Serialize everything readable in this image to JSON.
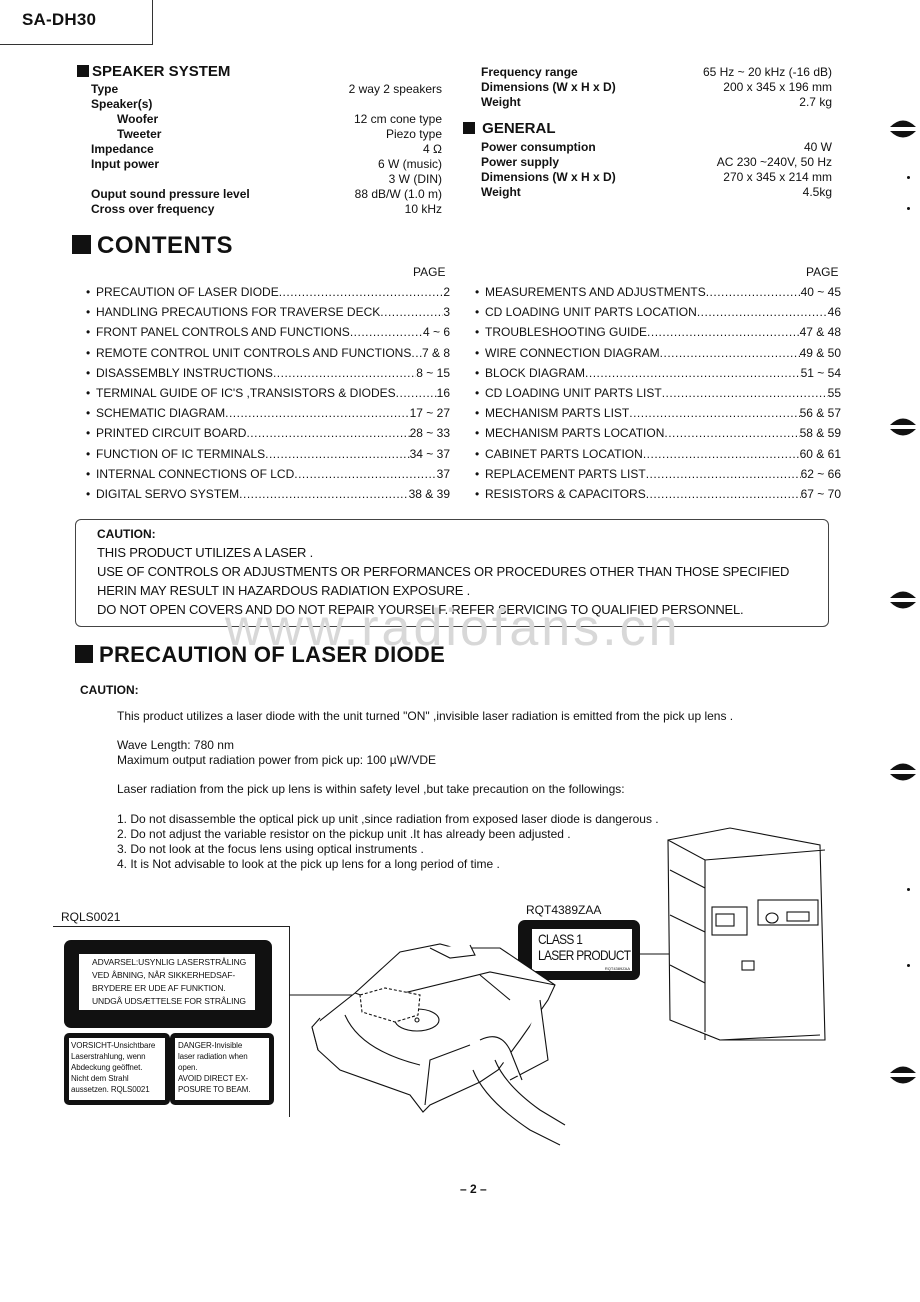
{
  "header": {
    "model": "SA-DH30"
  },
  "speaker_system": {
    "title": "SPEAKER SYSTEM",
    "rows": [
      {
        "label": "Type",
        "value": "2 way 2 speakers",
        "indent": false
      },
      {
        "label": "Speaker(s)",
        "value": "",
        "indent": false
      },
      {
        "label": "Woofer",
        "value": "12 cm cone type",
        "indent": true
      },
      {
        "label": "Tweeter",
        "value": "Piezo type",
        "indent": true
      },
      {
        "label": "Impedance",
        "value": "4 Ω",
        "indent": false
      },
      {
        "label": "Input power",
        "value": "6 W (music)",
        "indent": false
      },
      {
        "label": "",
        "value": "3 W (DIN)",
        "indent": false
      },
      {
        "label": "Ouput sound pressure level",
        "value": "88 dB/W (1.0 m)",
        "indent": false
      },
      {
        "label": "Cross over frequency",
        "value": "10 kHz",
        "indent": false
      }
    ],
    "more_rows": [
      {
        "label": "Frequency range",
        "value": "65 Hz ~ 20 kHz (-16 dB)"
      },
      {
        "label": "Dimensions (W x H x D)",
        "value": "200 x 345 x 196 mm"
      },
      {
        "label": "Weight",
        "value": "2.7 kg"
      }
    ]
  },
  "general": {
    "title": "GENERAL",
    "rows": [
      {
        "label": "Power consumption",
        "value": "40 W"
      },
      {
        "label": "Power supply",
        "value": "AC 230 ~240V, 50 Hz"
      },
      {
        "label": "Dimensions (W x H x D)",
        "value": "270 x 345 x 214 mm"
      },
      {
        "label": "Weight",
        "value": "4.5kg"
      }
    ]
  },
  "contents": {
    "title": "CONTENTS",
    "page_header": "PAGE",
    "left": [
      {
        "title": "PRECAUTION OF LASER DIODE",
        "page": "2"
      },
      {
        "title": "HANDLING PRECAUTIONS FOR TRAVERSE DECK",
        "page": "3"
      },
      {
        "title": "FRONT PANEL CONTROLS AND FUNCTIONS",
        "page": "4 ~ 6"
      },
      {
        "title": "REMOTE CONTROL UNIT CONTROLS AND FUNCTIONS",
        "page": "7 & 8"
      },
      {
        "title": "DISASSEMBLY INSTRUCTIONS",
        "page": "8 ~ 15"
      },
      {
        "title": "TERMINAL GUIDE OF IC'S ,TRANSISTORS & DIODES",
        "page": "16"
      },
      {
        "title": "SCHEMATIC DIAGRAM",
        "page": "17 ~ 27"
      },
      {
        "title": "PRINTED CIRCUIT BOARD",
        "page": "28 ~ 33"
      },
      {
        "title": "FUNCTION OF IC TERMINALS",
        "page": "34 ~ 37"
      },
      {
        "title": "INTERNAL CONNECTIONS OF LCD",
        "page": "37"
      },
      {
        "title": "DIGITAL SERVO SYSTEM",
        "page": "38 & 39"
      }
    ],
    "right": [
      {
        "title": "MEASUREMENTS AND ADJUSTMENTS",
        "page": "40 ~ 45"
      },
      {
        "title": "CD LOADING UNIT PARTS LOCATION",
        "page": "46"
      },
      {
        "title": "TROUBLESHOOTING GUIDE",
        "page": "47 & 48"
      },
      {
        "title": "WIRE CONNECTION DIAGRAM",
        "page": "49 & 50"
      },
      {
        "title": "BLOCK DIAGRAM",
        "page": "51 ~ 54"
      },
      {
        "title": "CD LOADING UNIT PARTS LIST",
        "page": "55"
      },
      {
        "title": "MECHANISM PARTS LIST",
        "page": "56 & 57"
      },
      {
        "title": "MECHANISM PARTS LOCATION",
        "page": "58 & 59"
      },
      {
        "title": "CABINET PARTS LOCATION",
        "page": "60 & 61"
      },
      {
        "title": "REPLACEMENT PARTS LIST",
        "page": "62 ~ 66"
      },
      {
        "title": "RESISTORS & CAPACITORS",
        "page": "67 ~ 70"
      }
    ]
  },
  "caution_box": {
    "heading": "CAUTION:",
    "lines": [
      "THIS PRODUCT UTILIZES A LASER .",
      "USE OF CONTROLS OR ADJUSTMENTS OR PERFORMANCES OR PROCEDURES OTHER THAN THOSE SPECIFIED",
      "HERIN MAY RESULT IN HAZARDOUS RADIATION EXPOSURE .",
      "DO NOT OPEN COVERS AND DO NOT REPAIR YOURSELF. REFER SERVICING TO QUALIFIED PERSONNEL."
    ]
  },
  "watermark": "www.radiofans.cn",
  "precaution": {
    "title": "PRECAUTION OF LASER DIODE",
    "caution_label": "CAUTION:",
    "intro": "This product utilizes a laser diode with the unit turned \"ON\" ,invisible laser radiation is emitted from the pick up lens .",
    "wave_length": "Wave Length: 780 nm",
    "max_power": "Maximum output radiation power from pick up: 100 µW/VDE",
    "safety": "Laser radiation from the pick up lens is  within safety level ,but take precaution on the followings:",
    "items": [
      "1. Do not disassemble the optical pick up unit ,since radiation from exposed laser diode is dangerous .",
      "2. Do not adjust the variable resistor on the pickup unit .It has already been adjusted .",
      "3. Do not look at the focus lens using optical instruments .",
      "4. It is Not advisable to look at the pick up lens for a long period of time ."
    ]
  },
  "labels": {
    "rqls_code": "RQLS0021",
    "danish": [
      "ADVARSEL:USYNLIG LASERSTRÅLING",
      "VED ÅBNING, NÅR SIKKERHEDSAF-",
      "BRYDERE ER UDE AF FUNKTION.",
      "UNDGÅ UDSÆTTELSE FOR STRÅLING"
    ],
    "german": [
      "VORSICHT-Unsichtbare",
      "Laserstrahlung, wenn",
      "Abdeckung geöffnet.",
      "Nicht dem Strahl",
      "aussetzen.   RQLS0021"
    ],
    "english": [
      "DANGER-Invisible",
      "laser radiation when",
      "open.",
      "AVOID DIRECT EX-",
      "POSURE TO BEAM."
    ],
    "rqt_code": "RQT4389ZAA",
    "class1_line1": "CLASS 1",
    "class1_line2": "LASER PRODUCT",
    "class1_small": "RQT4389ZAA"
  },
  "footer": {
    "page": "– 2 –"
  }
}
